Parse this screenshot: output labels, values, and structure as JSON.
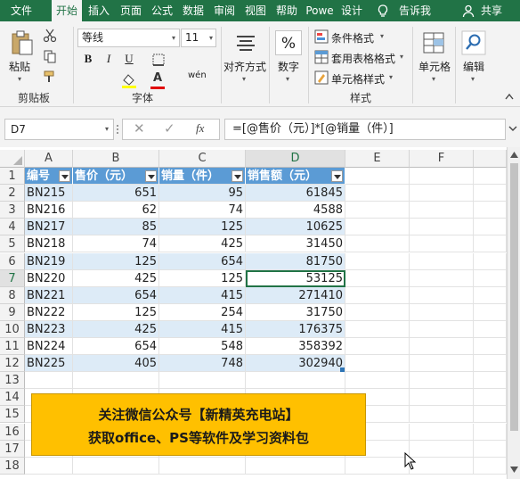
{
  "ribbon": {
    "tabs": [
      "文件",
      "开始",
      "插入",
      "页面",
      "公式",
      "数据",
      "审阅",
      "视图",
      "帮助",
      "Powe",
      "设计"
    ],
    "active_tab": "开始",
    "tell_me": "告诉我",
    "share": "共享",
    "clipboard": {
      "paste_label": "粘贴",
      "group_label": "剪贴板"
    },
    "font": {
      "font_name": "等线",
      "font_size": "11",
      "bold": "B",
      "italic": "I",
      "underline": "U",
      "phonetic_label": "wén",
      "font_color_glyph": "A",
      "group_label": "字体"
    },
    "alignment": {
      "label": "对齐方式"
    },
    "number": {
      "label": "数字",
      "percent_glyph": "%"
    },
    "styles": {
      "conditional_format": "条件格式",
      "format_as_table": "套用表格格式",
      "cell_styles": "单元格样式",
      "group_label": "样式"
    },
    "cells": {
      "label": "单元格"
    },
    "editing": {
      "label": "编辑"
    }
  },
  "formula_bar": {
    "name_box": "D7",
    "fx": "fx",
    "formula": "=[@售价（元）]*[@销量（件）]"
  },
  "sheet": {
    "columns": [
      "A",
      "B",
      "C",
      "D",
      "E",
      "F"
    ],
    "rows": [
      "1",
      "2",
      "3",
      "4",
      "5",
      "6",
      "7",
      "8",
      "9",
      "10",
      "11",
      "12",
      "13",
      "14",
      "15",
      "16",
      "17",
      "18"
    ],
    "table_headers": [
      "编号",
      "售价（元）",
      "销量（件）",
      "销售额（元）"
    ],
    "table_rows": [
      [
        "BN215",
        "651",
        "95",
        "61845"
      ],
      [
        "BN216",
        "62",
        "74",
        "4588"
      ],
      [
        "BN217",
        "85",
        "125",
        "10625"
      ],
      [
        "BN218",
        "74",
        "425",
        "31450"
      ],
      [
        "BN219",
        "125",
        "654",
        "81750"
      ],
      [
        "BN220",
        "425",
        "125",
        "53125"
      ],
      [
        "BN221",
        "654",
        "415",
        "271410"
      ],
      [
        "BN222",
        "125",
        "254",
        "31750"
      ],
      [
        "BN223",
        "425",
        "415",
        "176375"
      ],
      [
        "BN224",
        "654",
        "548",
        "358392"
      ],
      [
        "BN225",
        "405",
        "748",
        "302940"
      ]
    ]
  },
  "banner": {
    "line1": "关注微信公众号【新精英充电站】",
    "line2": "获取office、PS等软件及学习资料包"
  },
  "colors": {
    "ribbon_green": "#217346",
    "table_header": "#5b9bd5",
    "table_band": "#ddebf7",
    "banner": "#ffc000"
  }
}
